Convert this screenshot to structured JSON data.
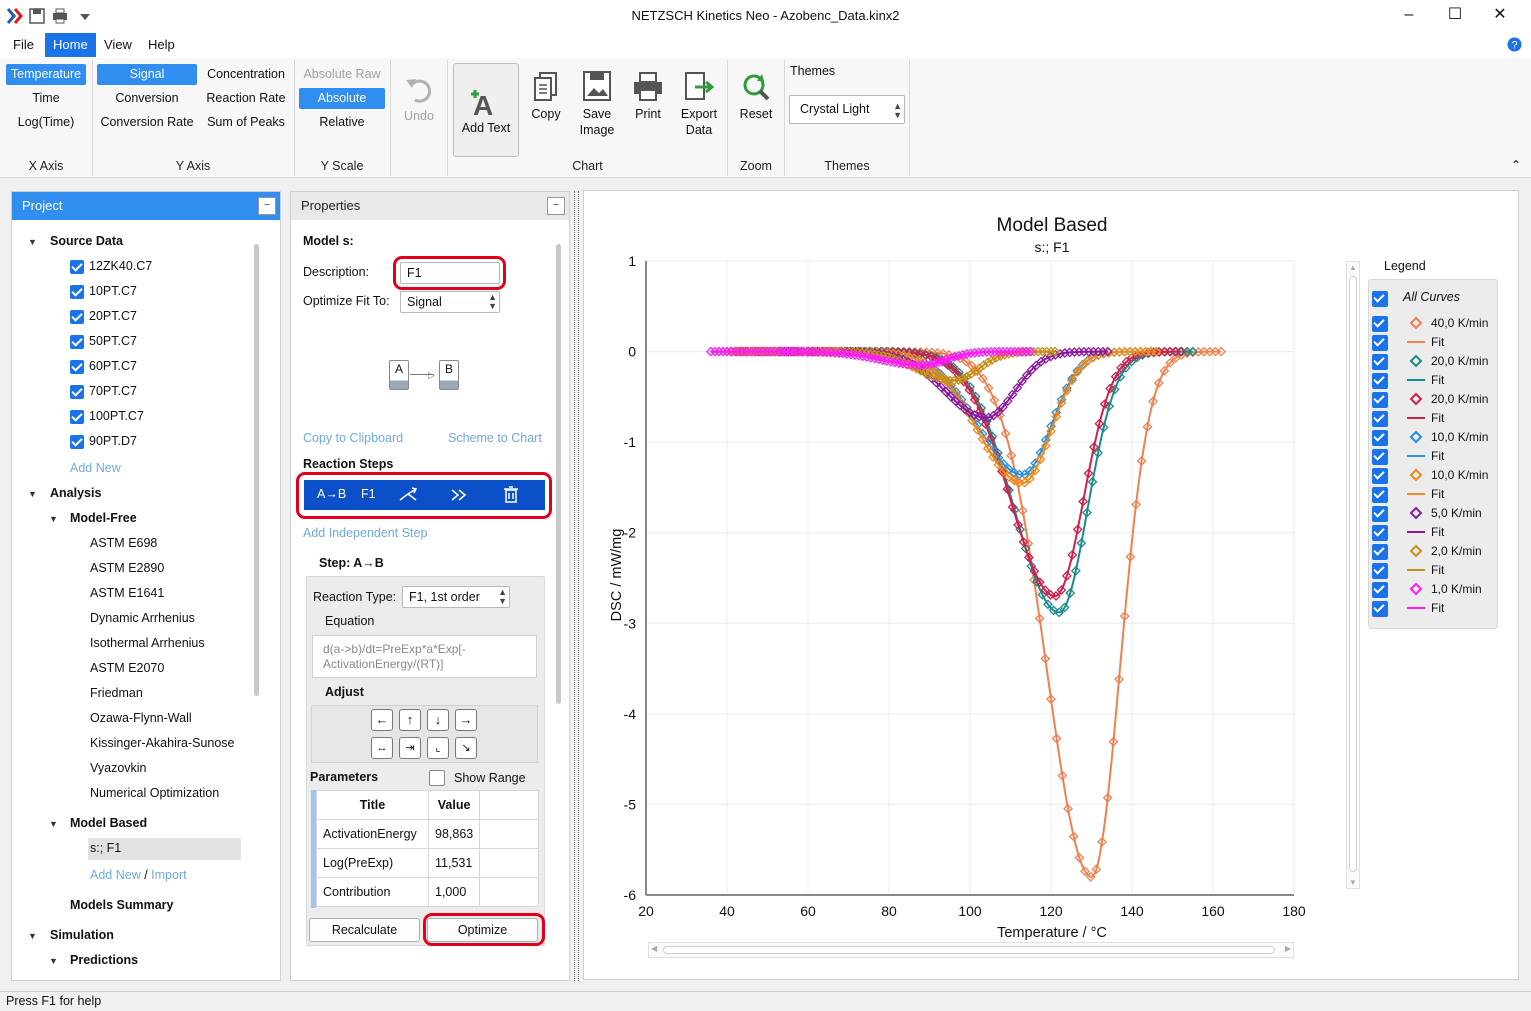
{
  "window": {
    "title": "NETZSCH Kinetics Neo - Azobenc_Data.kinx2"
  },
  "menu": [
    "File",
    "Home",
    "View",
    "Help"
  ],
  "ribbon": {
    "xaxis": {
      "label": "X Axis",
      "items": [
        "Temperature",
        "Time",
        "Log(Time)"
      ]
    },
    "yaxis": {
      "label": "Y Axis",
      "col1": [
        "Signal",
        "Conversion",
        "Conversion Rate"
      ],
      "col2": [
        "Concentration",
        "Reaction Rate",
        "Sum of Peaks"
      ]
    },
    "yscale": {
      "label": "Y Scale",
      "items": [
        "Absolute Raw",
        "Absolute",
        "Relative"
      ]
    },
    "undo": "Undo",
    "chart": {
      "label": "Chart",
      "add_text": "Add Text",
      "copy": "Copy",
      "save1": "Save",
      "save2": "Image",
      "print": "Print",
      "export1": "Export",
      "export2": "Data"
    },
    "zoom": {
      "label": "Zoom",
      "reset": "Reset"
    },
    "themes": {
      "label": "Themes",
      "header": "Themes",
      "value": "Crystal Light"
    }
  },
  "project": {
    "title": "Project",
    "source_data": "Source Data",
    "files": [
      "12ZK40.C7",
      "10PT.C7",
      "20PT.C7",
      "50PT.C7",
      "60PT.C7",
      "70PT.C7",
      "100PT.C7",
      "90PT.D7"
    ],
    "add_new": "Add New",
    "analysis": "Analysis",
    "model_free": "Model-Free",
    "mf_methods": [
      "ASTM E698",
      "ASTM E2890",
      "ASTM E1641",
      "Dynamic Arrhenius",
      "Isothermal Arrhenius",
      "ASTM E2070",
      "Friedman",
      "Ozawa-Flynn-Wall",
      "Kissinger-Akahira-Sunose",
      "Vyazovkin",
      "Numerical Optimization"
    ],
    "model_based": "Model Based",
    "mb_item": "s:; F1",
    "add_new2": "Add New",
    "slash": " / ",
    "import": "Import",
    "models_summary": "Models Summary",
    "simulation": "Simulation",
    "predictions": "Predictions"
  },
  "properties": {
    "title": "Properties",
    "model_label": "Model s:",
    "description_label": "Description:",
    "description_value": "F1",
    "optimize_label": "Optimize Fit To:",
    "optimize_value": "Signal",
    "scheme_a": "A",
    "scheme_b": "B",
    "copy_clipboard": "Copy to Clipboard",
    "scheme_to_chart": "Scheme to Chart",
    "reaction_steps": "Reaction Steps",
    "step_name": "A→B",
    "step_type": "F1",
    "add_independent": "Add Independent Step",
    "step_title": "Step: A→B",
    "reaction_type_label": "Reaction Type:",
    "reaction_type_value": "F1, 1st order",
    "equation_label": "Equation",
    "equation_text": "d(a->b)/dt=PreExp*a*Exp[-ActivationEnergy/(RT)]",
    "adjust_label": "Adjust",
    "parameters_label": "Parameters",
    "show_range": "Show Range",
    "col_title": "Title",
    "col_value": "Value",
    "params": [
      {
        "title": "ActivationEnergy",
        "value": "98,863"
      },
      {
        "title": "Log(PreExp)",
        "value": "11,531"
      },
      {
        "title": "Contribution",
        "value": "1,000"
      }
    ],
    "recalculate": "Recalculate",
    "optimize": "Optimize"
  },
  "legend": {
    "title": "Legend",
    "all_curves": "All Curves",
    "entries": [
      {
        "label": "40,0 K/min",
        "kind": "diamond",
        "color": "#f0804f"
      },
      {
        "label": "Fit",
        "kind": "line",
        "color": "#f0804f"
      },
      {
        "label": "20,0 K/min",
        "kind": "diamond",
        "color": "#1a8a8a"
      },
      {
        "label": "Fit",
        "kind": "line",
        "color": "#1a8a8a"
      },
      {
        "label": "20,0 K/min",
        "kind": "diamond",
        "color": "#d0204a"
      },
      {
        "label": "Fit",
        "kind": "line",
        "color": "#d0204a"
      },
      {
        "label": "10,0 K/min",
        "kind": "diamond",
        "color": "#2a8ed8"
      },
      {
        "label": "Fit",
        "kind": "line",
        "color": "#2a8ed8"
      },
      {
        "label": "10,0 K/min",
        "kind": "diamond",
        "color": "#f08a1a"
      },
      {
        "label": "Fit",
        "kind": "line",
        "color": "#f08a1a"
      },
      {
        "label": "5,0 K/min",
        "kind": "diamond",
        "color": "#8a1aa0"
      },
      {
        "label": "Fit",
        "kind": "line",
        "color": "#8a1aa0"
      },
      {
        "label": "2,0 K/min",
        "kind": "diamond",
        "color": "#c8901a"
      },
      {
        "label": "Fit",
        "kind": "line",
        "color": "#c8901a"
      },
      {
        "label": "1,0 K/min",
        "kind": "diamond",
        "color": "#ff1aff"
      },
      {
        "label": "Fit",
        "kind": "line",
        "color": "#ff1aff"
      }
    ]
  },
  "status": "Press F1 for help",
  "chart_data": {
    "type": "scatter",
    "title": "Model Based",
    "subtitle": "s:; F1",
    "xlabel": "Temperature / °C",
    "ylabel": "DSC / mW/mg",
    "xlim": [
      20,
      180
    ],
    "ylim": [
      -6,
      1
    ],
    "xticks": [
      20,
      40,
      60,
      80,
      100,
      120,
      140,
      160,
      180
    ],
    "yticks": [
      1,
      0,
      -1,
      -2,
      -3,
      -4,
      -5,
      -6
    ],
    "grid": true,
    "legend": "right",
    "series": [
      {
        "name": "40,0 K/min",
        "color": "#f0804f",
        "start": 50,
        "end": 162,
        "peak_x": 130,
        "peak_y": -5.8,
        "sigma_l": 11,
        "sigma_r": 7
      },
      {
        "name": "20,0 K/min",
        "color": "#1a8a8a",
        "start": 45,
        "end": 155,
        "peak_x": 122,
        "peak_y": -2.88,
        "sigma_l": 11,
        "sigma_r": 7
      },
      {
        "name": "20,0 K/min",
        "color": "#d0204a",
        "start": 45,
        "end": 152,
        "peak_x": 121,
        "peak_y": -2.7,
        "sigma_l": 11,
        "sigma_r": 7
      },
      {
        "name": "10,0 K/min",
        "color": "#2a8ed8",
        "start": 42,
        "end": 146,
        "peak_x": 113,
        "peak_y": -1.36,
        "sigma_l": 11,
        "sigma_r": 7
      },
      {
        "name": "10,0 K/min",
        "color": "#f08a1a",
        "start": 42,
        "end": 146,
        "peak_x": 113,
        "peak_y": -1.45,
        "sigma_l": 11,
        "sigma_r": 7
      },
      {
        "name": "5,0 K/min",
        "color": "#8a1aa0",
        "start": 40,
        "end": 134,
        "peak_x": 104,
        "peak_y": -0.73,
        "sigma_l": 10,
        "sigma_r": 7
      },
      {
        "name": "2,0 K/min",
        "color": "#c8901a",
        "start": 38,
        "end": 121,
        "peak_x": 96,
        "peak_y": -0.32,
        "sigma_l": 9,
        "sigma_r": 6
      },
      {
        "name": "1,0 K/min",
        "color": "#ff1aff",
        "start": 36,
        "end": 115,
        "peak_x": 88,
        "peak_y": -0.15,
        "sigma_l": 10,
        "sigma_r": 6
      }
    ]
  }
}
